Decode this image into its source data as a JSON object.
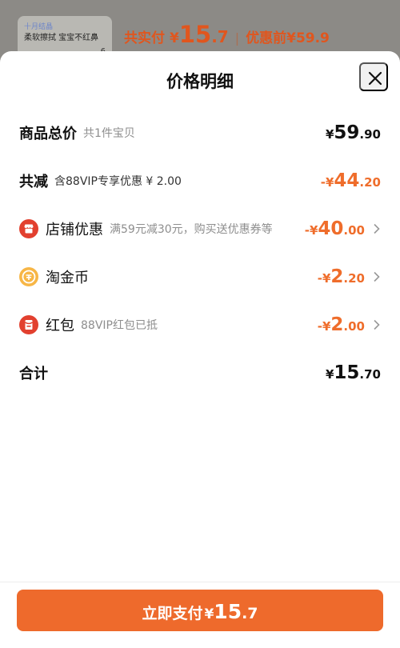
{
  "background": {
    "thumbnail": {
      "brand": "十月结晶",
      "line": "柔软擦拭 宝宝不红鼻",
      "qty": "6"
    },
    "summary": {
      "paid_label": "共实付",
      "currency": "¥",
      "paid_int": "15",
      "paid_frac": ".7",
      "separator": "|",
      "before_label": "优惠前¥59.9"
    }
  },
  "sheet": {
    "title": "价格明细",
    "close_icon": "close-icon"
  },
  "rows": {
    "total": {
      "label": "商品总价",
      "sub": "共1件宝贝",
      "currency": "¥",
      "int": "59",
      "frac": ".90"
    },
    "reduced": {
      "label": "共减",
      "sub": "含88VIP专享优惠 ¥ 2.00",
      "currency": "-¥",
      "int": "44",
      "frac": ".20"
    },
    "store": {
      "icon": "store-icon",
      "label": "店铺优惠",
      "sub": "满59元减30元，购买送优惠券等",
      "currency": "-¥",
      "int": "40",
      "frac": ".00"
    },
    "coin": {
      "icon": "coin-icon",
      "label": "淘金币",
      "currency": "-¥",
      "int": "2",
      "frac": ".20"
    },
    "redpacket": {
      "icon": "red-packet-icon",
      "label": "红包",
      "sub": "88VIP红包已抵",
      "currency": "-¥",
      "int": "2",
      "frac": ".00"
    },
    "sum": {
      "label": "合计",
      "currency": "¥",
      "int": "15",
      "frac": ".70"
    }
  },
  "footer": {
    "pay_label": "立即支付",
    "currency": "¥",
    "int": "15",
    "frac": ".7"
  },
  "colors": {
    "accent": "#ee6a2c",
    "discount": "#ef6d2b",
    "store_icon": "#e2402f",
    "coin_icon": "#f7b646"
  }
}
